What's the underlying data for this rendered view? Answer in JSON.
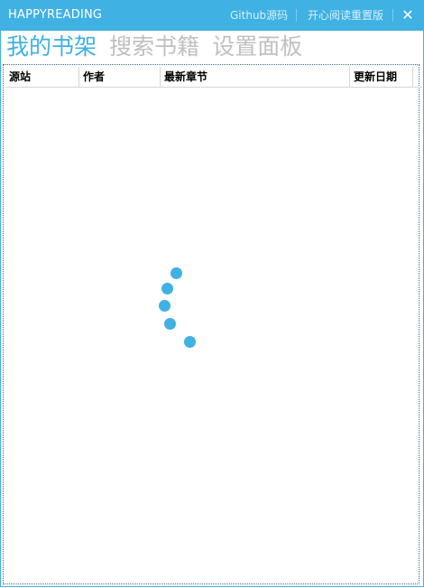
{
  "app": {
    "title": "HAPPYREADING"
  },
  "titlebar": {
    "github_link": "Github源码",
    "reset_link": "开心阅读重置版",
    "close_glyph": "✕"
  },
  "tabs": [
    {
      "label": "我的书架",
      "active": true
    },
    {
      "label": "搜索书籍",
      "active": false
    },
    {
      "label": "设置面板",
      "active": false
    }
  ],
  "bookshelf": {
    "columns": [
      "源站",
      "作者",
      "最新章节",
      "更新日期"
    ],
    "rows": []
  },
  "colors": {
    "accent": "#3fb1e3",
    "inactive_tab": "#c0c0c0"
  },
  "icons": {
    "loading": "loading-spinner-icon",
    "close": "close-icon"
  }
}
